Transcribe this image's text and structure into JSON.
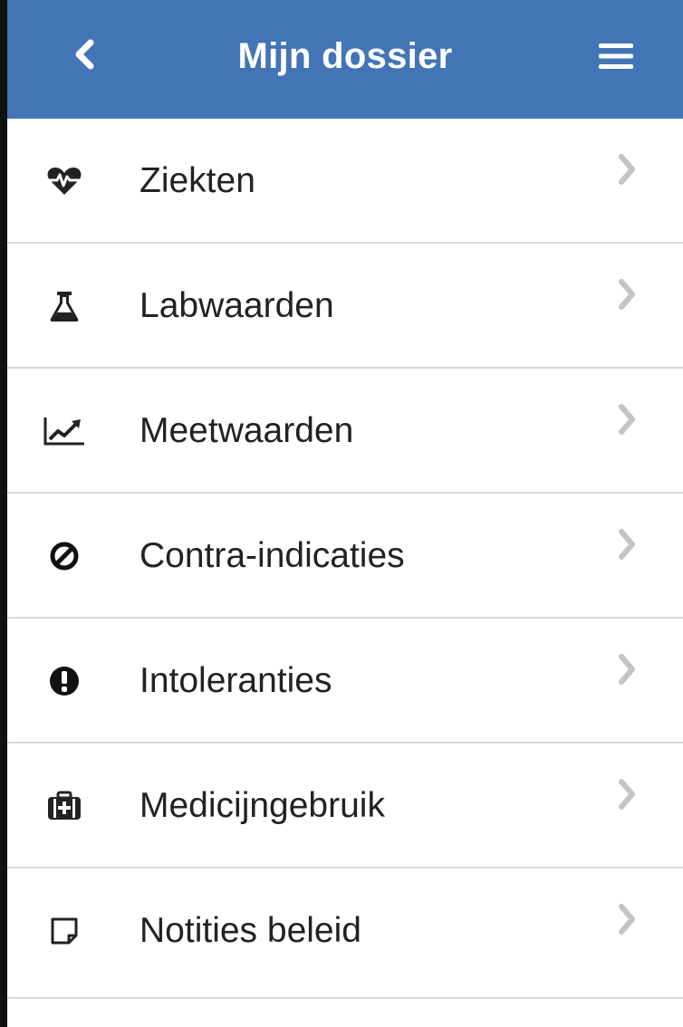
{
  "header": {
    "title": "Mijn dossier",
    "back_icon": "chevron-left-icon",
    "menu_icon": "hamburger-menu-icon",
    "background_color": "#4374b6"
  },
  "menu_items": [
    {
      "label": "Ziekten",
      "icon": "heartbeat-icon"
    },
    {
      "label": "Labwaarden",
      "icon": "flask-icon"
    },
    {
      "label": "Meetwaarden",
      "icon": "line-chart-icon"
    },
    {
      "label": "Contra-indicaties",
      "icon": "ban-icon"
    },
    {
      "label": "Intoleranties",
      "icon": "exclamation-circle-icon"
    },
    {
      "label": "Medicijngebruik",
      "icon": "medkit-icon"
    },
    {
      "label": "Notities beleid",
      "icon": "sticky-note-icon"
    }
  ]
}
